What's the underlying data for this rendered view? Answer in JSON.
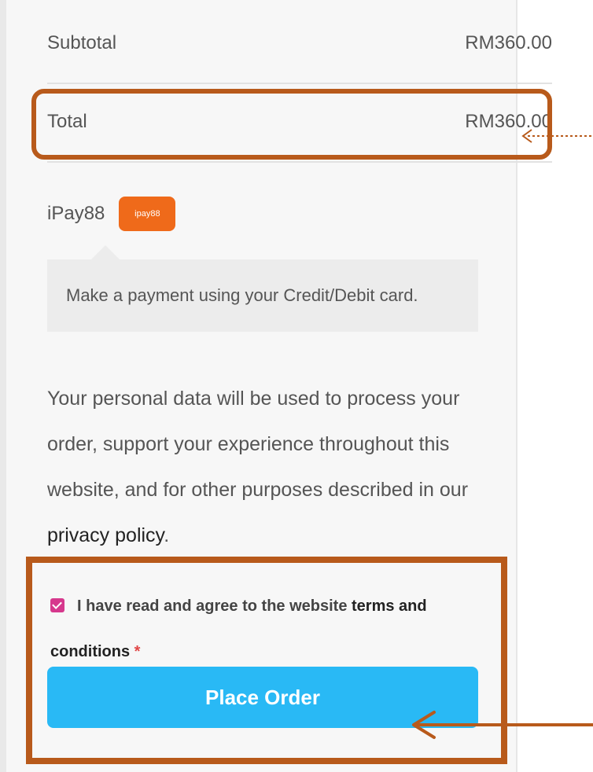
{
  "order_summary": {
    "subtotal_label": "Subtotal",
    "subtotal_value": "RM360.00",
    "total_label": "Total",
    "total_value": "RM360.00"
  },
  "payment": {
    "method_name": "iPay88",
    "badge_text": "ipay88",
    "description": "Make a payment using your Credit/Debit card."
  },
  "privacy": {
    "text": "Your personal data will be used to process your order, support your experience throughout this website, and for other purposes described in our",
    "link_text": "privacy policy",
    "suffix": "."
  },
  "terms": {
    "checked": true,
    "prefix": "I have read and agree to the website",
    "link_text": "terms and conditions",
    "required_marker": "*"
  },
  "cta": {
    "label": "Place Order"
  },
  "colors": {
    "annotation": "#b85a1b",
    "button_bg": "#29b9f5",
    "badge_bg": "#ef6a1a",
    "checkbox": "#d6388d"
  }
}
